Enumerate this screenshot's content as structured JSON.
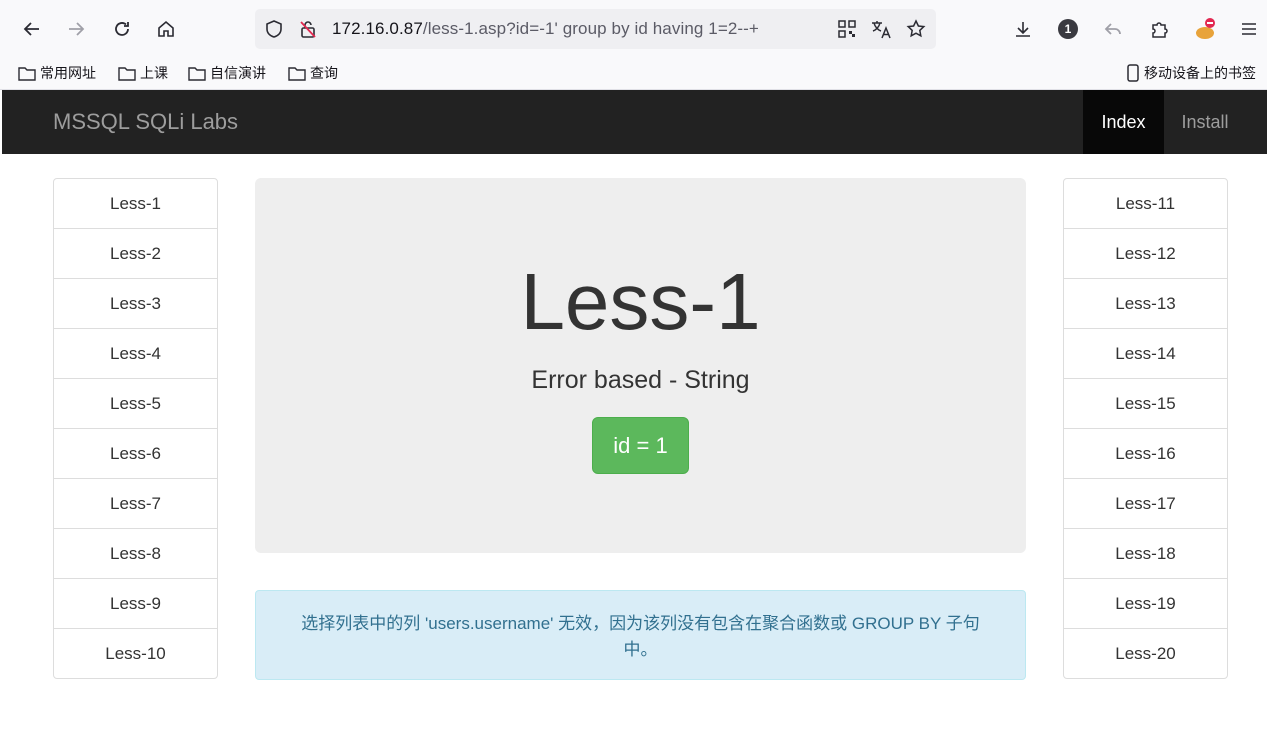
{
  "browser": {
    "url_host": "172.16.0.87",
    "url_path": "/less-1.asp?id=-1' group by id having 1=2--+",
    "notification_count": "1",
    "bookmarks": [
      {
        "label": "常用网址"
      },
      {
        "label": "上课"
      },
      {
        "label": "自信演讲"
      },
      {
        "label": "查询"
      }
    ],
    "mobile_bookmarks": "移动设备上的书签"
  },
  "navbar": {
    "brand": "MSSQL SQLi Labs",
    "items": [
      {
        "label": "Index",
        "active": true
      },
      {
        "label": "Install",
        "active": false
      }
    ]
  },
  "left_list": [
    "Less-1",
    "Less-2",
    "Less-3",
    "Less-4",
    "Less-5",
    "Less-6",
    "Less-7",
    "Less-8",
    "Less-9",
    "Less-10"
  ],
  "right_list": [
    "Less-11",
    "Less-12",
    "Less-13",
    "Less-14",
    "Less-15",
    "Less-16",
    "Less-17",
    "Less-18",
    "Less-19",
    "Less-20"
  ],
  "jumbotron": {
    "title": "Less-1",
    "subtitle": "Error based - String",
    "button_label": "id = 1"
  },
  "alert": {
    "message": "选择列表中的列 'users.username' 无效，因为该列没有包含在聚合函数或 GROUP BY 子句中。"
  },
  "colors": {
    "navbar_bg": "#222222",
    "success": "#5cb85c",
    "alert_bg": "#d9edf7",
    "alert_text": "#31708f"
  }
}
